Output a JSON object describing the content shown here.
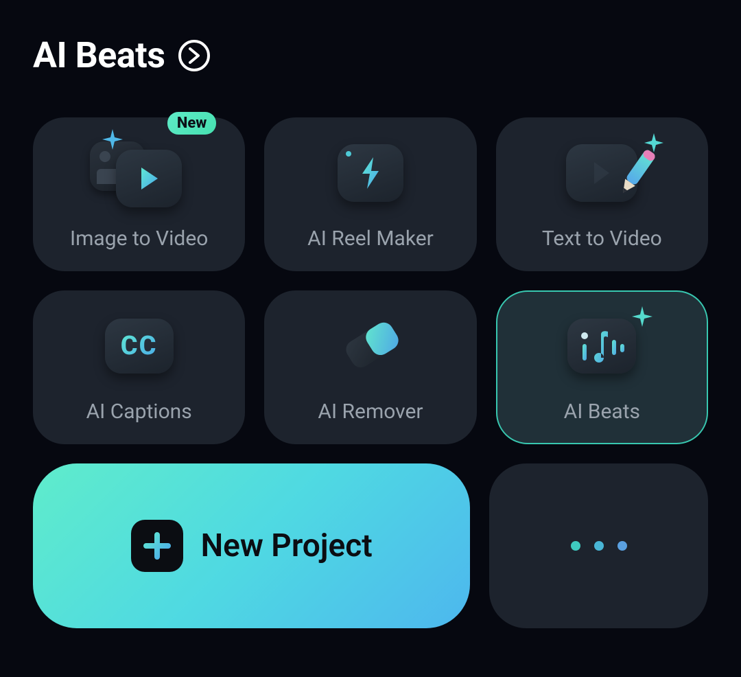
{
  "header": {
    "title": "AI Beats"
  },
  "cards": [
    {
      "label": "Image to Video",
      "badge": "New",
      "selected": false
    },
    {
      "label": "AI Reel Maker",
      "selected": false
    },
    {
      "label": "Text to Video",
      "selected": false
    },
    {
      "label": "AI Captions",
      "selected": false
    },
    {
      "label": "AI Remover",
      "selected": false
    },
    {
      "label": "AI Beats",
      "selected": true
    }
  ],
  "actions": {
    "new_project": "New Project"
  },
  "colors": {
    "accent_teal": "#54e6c3",
    "accent_blue": "#4db7ee",
    "dot1": "#3fcac0",
    "dot2": "#49b6d6",
    "dot3": "#5aa0e0"
  }
}
